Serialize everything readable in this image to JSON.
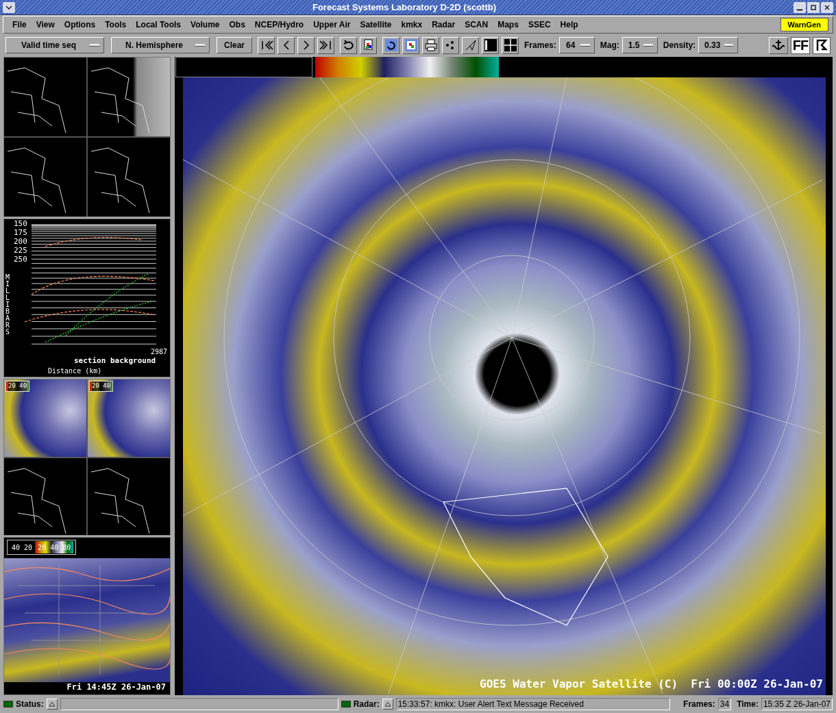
{
  "window": {
    "title": "Forecast Systems Laboratory D-2D (scottb)"
  },
  "menu": [
    "File",
    "View",
    "Options",
    "Tools",
    "Local Tools",
    "Volume",
    "Obs",
    "NCEP/Hydro",
    "Upper Air",
    "Satellite",
    "kmkx",
    "Radar",
    "SCAN",
    "Maps",
    "SSEC",
    "Help"
  ],
  "warngen": "WarnGen",
  "toolbar": {
    "dropdowns": [
      "Valid time seq",
      "N. Hemisphere"
    ],
    "clear": "Clear",
    "settings": [
      {
        "label": "Frames:",
        "value": "64"
      },
      {
        "label": "Mag:",
        "value": "1.5"
      },
      {
        "label": "Density:",
        "value": "0.33"
      }
    ],
    "ff": "FF"
  },
  "left_panels": [
    {
      "kind": "map_grid"
    },
    {
      "kind": "cross_section",
      "y_label": "MILLIBARS",
      "levels": [
        "150",
        "175",
        "200",
        "225",
        "250"
      ],
      "x_label": "Distance (km)",
      "title": "section background",
      "corner": "2987"
    },
    {
      "kind": "sat_grid",
      "scale_labels": [
        "20 40",
        "20 40"
      ]
    },
    {
      "kind": "sat_overlay",
      "scale_label": "40 20",
      "scale_values": "20 40 80",
      "caption": "Fri 14:45Z 26-Jan-07"
    }
  ],
  "main_image": {
    "caption": "GOES Water Vapor Satellite (C)  Fri 00:00Z 26-Jan-07"
  },
  "status_bar": {
    "status_label": "Status:",
    "radar_label": "Radar:",
    "message": "15:33:57: kmkx: User Alert Text Message Received",
    "frames_label": "Frames:",
    "frames": "34",
    "time_label": "Time:",
    "time": "15:35 Z 26-Jan-07"
  }
}
